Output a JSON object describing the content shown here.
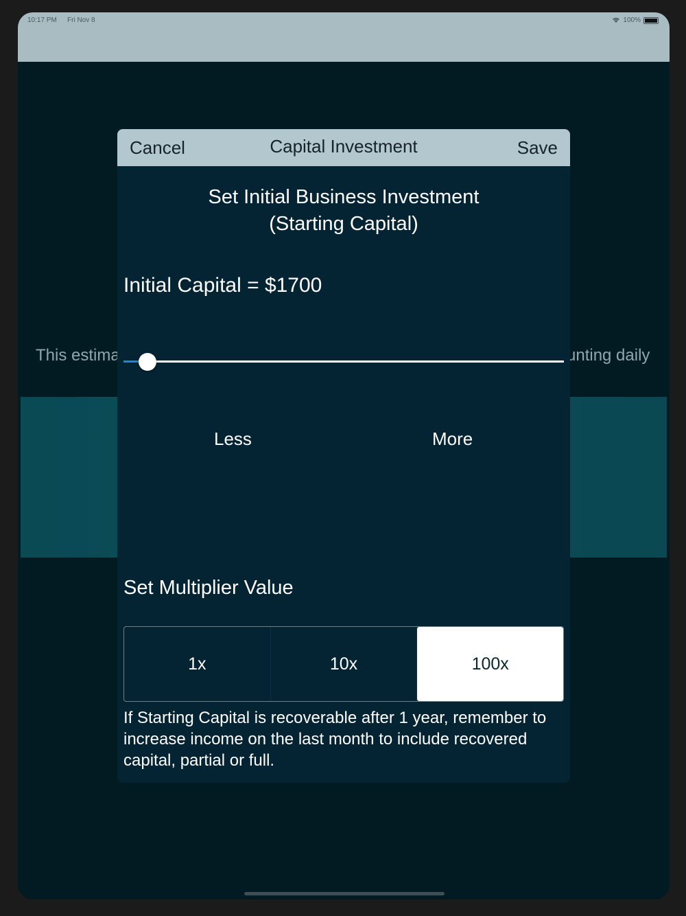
{
  "status_bar": {
    "time": "10:17 PM",
    "date": "Fri Nov 8",
    "battery": "100%"
  },
  "background": {
    "text_left": "This estima",
    "text_right": "unting daily"
  },
  "modal": {
    "header": {
      "cancel_label": "Cancel",
      "title": "Capital Investment",
      "save_label": "Save"
    },
    "heading_line1": "Set Initial Business Investment",
    "heading_line2": "(Starting Capital)",
    "capital_label": "Initial Capital = $1700",
    "slider": {
      "value_fraction": 0.035
    },
    "less_label": "Less",
    "more_label": "More",
    "multiplier_label": "Set Multiplier Value",
    "multiplier_options": [
      "1x",
      "10x",
      "100x"
    ],
    "multiplier_selected": "100x",
    "note": "If Starting Capital is recoverable after 1 year, remember to increase income on the last month to include recovered capital, partial or full."
  },
  "colors": {
    "modal_bg": "#042433",
    "header_bg": "#b3c8ce",
    "accent": "#2a7de1"
  }
}
